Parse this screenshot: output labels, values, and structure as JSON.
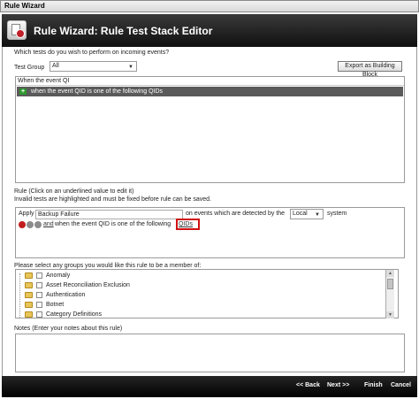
{
  "window": {
    "title": "Rule Wizard"
  },
  "header": {
    "title": "Rule Wizard: Rule Test Stack Editor",
    "icon": "rule-document-icon"
  },
  "tests": {
    "prompt": "Which tests do you wish to perform on incoming events?",
    "test_group_label": "Test Group",
    "test_group_value": "All",
    "export_button": "Export as Building Block",
    "search_text": "When the event QI",
    "result_item": "when the event QID is one of the following QIDs"
  },
  "rule": {
    "label": "Rule (Click on an underlined value to edit it)",
    "hint": "Invalid tests are highlighted and must be fixed before rule can be saved.",
    "apply_label": "Apply",
    "rule_name": "Backup Failure",
    "on_events": "on events which are detected by the",
    "system_select": "Local",
    "system_label": "system",
    "and_link": "and",
    "condition_text": "when the event QID is one of the following",
    "qids_link": "QIDs"
  },
  "groups": {
    "label": "Please select any groups you would like this rule to be a member of:",
    "items": [
      "Anomaly",
      "Asset Reconciliation Exclusion",
      "Authentication",
      "Botnet",
      "Category Definitions"
    ]
  },
  "notes": {
    "label": "Notes (Enter your notes about this rule)",
    "value": ""
  },
  "footer": {
    "back": "<< Back",
    "next": "Next >>",
    "finish": "Finish",
    "cancel": "Cancel"
  },
  "colors": {
    "header_bg": "#1a1a1a",
    "selected_row": "#5a5a5a",
    "error_outline": "#d01010",
    "add_icon": "#2e9a2e"
  }
}
